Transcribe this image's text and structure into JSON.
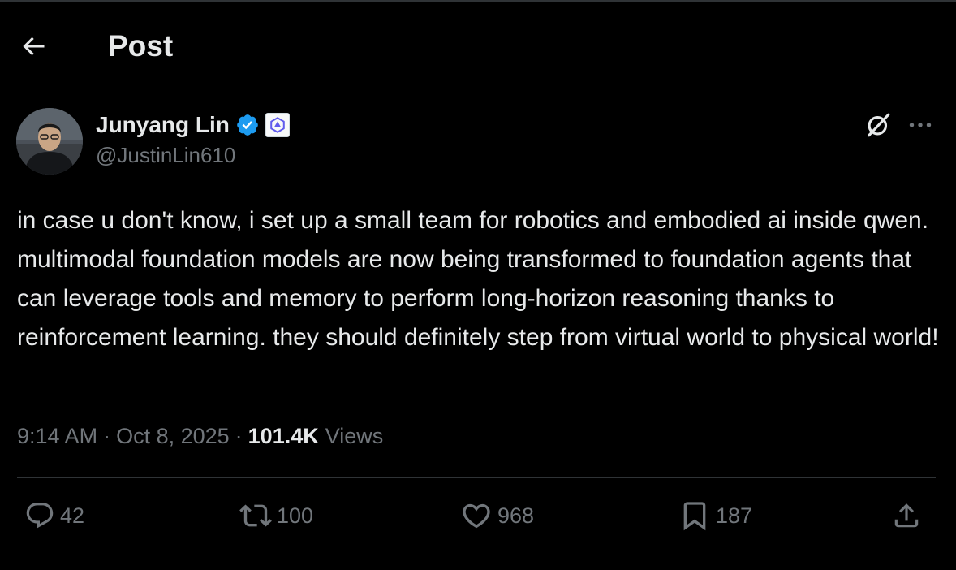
{
  "header": {
    "title": "Post"
  },
  "author": {
    "name": "Junyang Lin",
    "handle": "@JustinLin610"
  },
  "post": {
    "text": "in case u don't know, i set up a small team for robotics and embodied ai inside qwen. multimodal foundation models are now being transformed to foundation agents that can leverage tools and memory to perform long-horizon reasoning thanks to reinforcement learning. they should definitely step from virtual world to physical world!",
    "time": "9:14 AM",
    "date": "Oct 8, 2025",
    "separator": "·",
    "views_count": "101.4K",
    "views_label": "Views"
  },
  "actions": {
    "replies": "42",
    "reposts": "100",
    "likes": "968",
    "bookmarks": "187"
  },
  "colors": {
    "background": "#000000",
    "text": "#e7e9ea",
    "secondary": "#71767b",
    "divider": "#2f3336",
    "verified": "#1d9bf0",
    "affiliate_accent": "#615ced"
  },
  "icons": {
    "back": "arrow-left-icon",
    "verified": "verified-badge-icon",
    "affiliate": "qwen-logo-icon",
    "grok": "grok-icon",
    "more": "more-dots-icon",
    "reply": "reply-icon",
    "repost": "repost-icon",
    "like": "heart-icon",
    "bookmark": "bookmark-icon",
    "share": "share-icon"
  }
}
